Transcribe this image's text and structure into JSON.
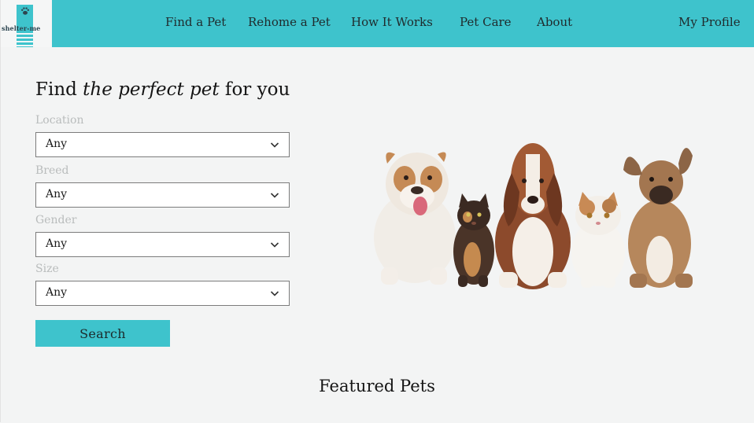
{
  "brand": {
    "logo_text": "shelter-me",
    "accent": "#3ec3cc"
  },
  "nav": {
    "items": [
      {
        "label": "Find a Pet"
      },
      {
        "label": "Rehome a Pet"
      },
      {
        "label": "How It Works"
      },
      {
        "label": "Pet Care"
      },
      {
        "label": "About"
      }
    ],
    "profile_label": "My Profile"
  },
  "hero": {
    "headline_prefix": "Find ",
    "headline_emphasis": "the perfect pet",
    "headline_suffix": " for you",
    "image_subject": "two dogs, a kitten, a basset hound, a cat and a puppy sitting in a row"
  },
  "form": {
    "fields": [
      {
        "label": "Location",
        "value": "Any"
      },
      {
        "label": "Breed",
        "value": "Any"
      },
      {
        "label": "Gender",
        "value": "Any"
      },
      {
        "label": "Size",
        "value": "Any"
      }
    ],
    "search_label": "Search"
  },
  "featured": {
    "title": "Featured Pets"
  }
}
